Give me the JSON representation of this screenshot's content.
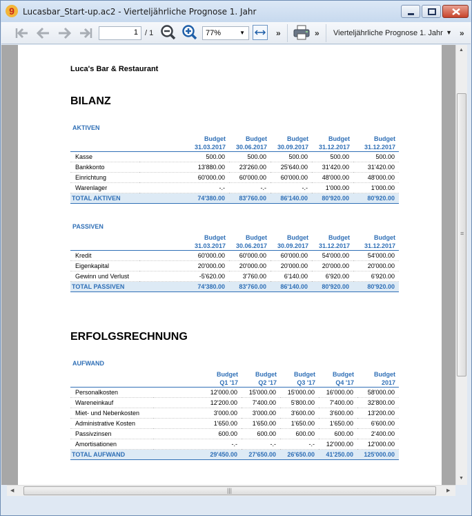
{
  "window": {
    "title": "Lucasbar_Start-up.ac2 - Vierteljährliche Prognose 1. Jahr"
  },
  "toolbar": {
    "page_value": "1",
    "page_total": "/ 1",
    "zoom": "77%",
    "more": "»",
    "report_name": "Vierteljährliche Prognose 1. Jahr"
  },
  "report": {
    "company": "Luca's  Bar & Restaurant",
    "bilanz_title": "BILANZ",
    "erfolg_title": "ERFOLGSRECHNUNG",
    "aktiven": {
      "label": "AKTIVEN",
      "headers": [
        [
          "Budget",
          "31.03.2017"
        ],
        [
          "Budget",
          "30.06.2017"
        ],
        [
          "Budget",
          "30.09.2017"
        ],
        [
          "Budget",
          "31.12.2017"
        ],
        [
          "Budget",
          "31.12.2017"
        ]
      ],
      "rows": [
        {
          "label": "Kasse",
          "values": [
            "500.00",
            "500.00",
            "500.00",
            "500.00",
            "500.00"
          ]
        },
        {
          "label": "Bankkonto",
          "values": [
            "13'880.00",
            "23'260.00",
            "25'640.00",
            "31'420.00",
            "31'420.00"
          ]
        },
        {
          "label": "Einrichtung",
          "values": [
            "60'000.00",
            "60'000.00",
            "60'000.00",
            "48'000.00",
            "48'000.00"
          ]
        },
        {
          "label": "Warenlager",
          "values": [
            "-.-",
            "-.-",
            "-.-",
            "1'000.00",
            "1'000.00"
          ]
        }
      ],
      "total": {
        "label": "TOTAL AKTIVEN",
        "values": [
          "74'380.00",
          "83'760.00",
          "86'140.00",
          "80'920.00",
          "80'920.00"
        ]
      }
    },
    "passiven": {
      "label": "PASSIVEN",
      "headers": [
        [
          "Budget",
          "31.03.2017"
        ],
        [
          "Budget",
          "30.06.2017"
        ],
        [
          "Budget",
          "30.09.2017"
        ],
        [
          "Budget",
          "31.12.2017"
        ],
        [
          "Budget",
          "31.12.2017"
        ]
      ],
      "rows": [
        {
          "label": "Kredit",
          "values": [
            "60'000.00",
            "60'000.00",
            "60'000.00",
            "54'000.00",
            "54'000.00"
          ]
        },
        {
          "label": "Eigenkapital",
          "values": [
            "20'000.00",
            "20'000.00",
            "20'000.00",
            "20'000.00",
            "20'000.00"
          ]
        },
        {
          "label": "Gewinn und Verlust",
          "values": [
            "-5'620.00",
            "3'760.00",
            "6'140.00",
            "6'920.00",
            "6'920.00"
          ]
        }
      ],
      "total": {
        "label": "TOTAL PASSIVEN",
        "values": [
          "74'380.00",
          "83'760.00",
          "86'140.00",
          "80'920.00",
          "80'920.00"
        ]
      }
    },
    "aufwand": {
      "label": "AUFWAND",
      "headers": [
        [
          "Budget",
          "Q1 '17"
        ],
        [
          "Budget",
          "Q2 '17"
        ],
        [
          "Budget",
          "Q3 '17"
        ],
        [
          "Budget",
          "Q4 '17"
        ],
        [
          "Budget",
          "2017"
        ]
      ],
      "rows": [
        {
          "label": "Personalkosten",
          "values": [
            "12'000.00",
            "15'000.00",
            "15'000.00",
            "16'000.00",
            "58'000.00"
          ]
        },
        {
          "label": "Wareneinkauf",
          "values": [
            "12'200.00",
            "7'400.00",
            "5'800.00",
            "7'400.00",
            "32'800.00"
          ]
        },
        {
          "label": "Miet- und Nebenkosten",
          "values": [
            "3'000.00",
            "3'000.00",
            "3'600.00",
            "3'600.00",
            "13'200.00"
          ]
        },
        {
          "label": "Administrative Kosten",
          "values": [
            "1'650.00",
            "1'650.00",
            "1'650.00",
            "1'650.00",
            "6'600.00"
          ]
        },
        {
          "label": "Passivzinsen",
          "values": [
            "600.00",
            "600.00",
            "600.00",
            "600.00",
            "2'400.00"
          ]
        },
        {
          "label": "Amortisationen",
          "values": [
            "-.-",
            "-.-",
            "-.-",
            "12'000.00",
            "12'000.00"
          ]
        }
      ],
      "total": {
        "label": "TOTAL AUFWAND",
        "values": [
          "29'450.00",
          "27'650.00",
          "26'650.00",
          "41'250.00",
          "125'000.00"
        ]
      }
    }
  },
  "icons": {
    "app": "app-logo-icon",
    "nav": [
      "first-page-icon",
      "previous-page-icon",
      "next-page-icon",
      "last-page-icon"
    ],
    "zoom_out": "zoom-out-icon",
    "zoom_in": "zoom-in-icon",
    "fit_width": "fit-width-icon",
    "print": "printer-icon"
  },
  "colors": {
    "accent": "#2f6fb6",
    "total_row_bg": "#ddeaf5",
    "close_button": "#c7442c"
  }
}
